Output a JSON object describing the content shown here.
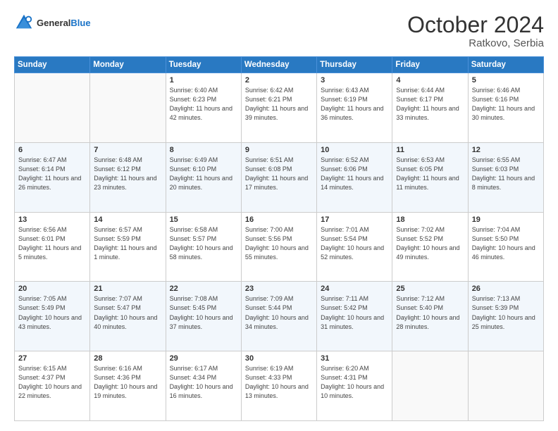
{
  "header": {
    "logo_line1": "General",
    "logo_line2": "Blue",
    "month": "October 2024",
    "location": "Ratkovo, Serbia"
  },
  "weekdays": [
    "Sunday",
    "Monday",
    "Tuesday",
    "Wednesday",
    "Thursday",
    "Friday",
    "Saturday"
  ],
  "weeks": [
    [
      {
        "day": "",
        "sunrise": "",
        "sunset": "",
        "daylight": ""
      },
      {
        "day": "",
        "sunrise": "",
        "sunset": "",
        "daylight": ""
      },
      {
        "day": "1",
        "sunrise": "Sunrise: 6:40 AM",
        "sunset": "Sunset: 6:23 PM",
        "daylight": "Daylight: 11 hours and 42 minutes."
      },
      {
        "day": "2",
        "sunrise": "Sunrise: 6:42 AM",
        "sunset": "Sunset: 6:21 PM",
        "daylight": "Daylight: 11 hours and 39 minutes."
      },
      {
        "day": "3",
        "sunrise": "Sunrise: 6:43 AM",
        "sunset": "Sunset: 6:19 PM",
        "daylight": "Daylight: 11 hours and 36 minutes."
      },
      {
        "day": "4",
        "sunrise": "Sunrise: 6:44 AM",
        "sunset": "Sunset: 6:17 PM",
        "daylight": "Daylight: 11 hours and 33 minutes."
      },
      {
        "day": "5",
        "sunrise": "Sunrise: 6:46 AM",
        "sunset": "Sunset: 6:16 PM",
        "daylight": "Daylight: 11 hours and 30 minutes."
      }
    ],
    [
      {
        "day": "6",
        "sunrise": "Sunrise: 6:47 AM",
        "sunset": "Sunset: 6:14 PM",
        "daylight": "Daylight: 11 hours and 26 minutes."
      },
      {
        "day": "7",
        "sunrise": "Sunrise: 6:48 AM",
        "sunset": "Sunset: 6:12 PM",
        "daylight": "Daylight: 11 hours and 23 minutes."
      },
      {
        "day": "8",
        "sunrise": "Sunrise: 6:49 AM",
        "sunset": "Sunset: 6:10 PM",
        "daylight": "Daylight: 11 hours and 20 minutes."
      },
      {
        "day": "9",
        "sunrise": "Sunrise: 6:51 AM",
        "sunset": "Sunset: 6:08 PM",
        "daylight": "Daylight: 11 hours and 17 minutes."
      },
      {
        "day": "10",
        "sunrise": "Sunrise: 6:52 AM",
        "sunset": "Sunset: 6:06 PM",
        "daylight": "Daylight: 11 hours and 14 minutes."
      },
      {
        "day": "11",
        "sunrise": "Sunrise: 6:53 AM",
        "sunset": "Sunset: 6:05 PM",
        "daylight": "Daylight: 11 hours and 11 minutes."
      },
      {
        "day": "12",
        "sunrise": "Sunrise: 6:55 AM",
        "sunset": "Sunset: 6:03 PM",
        "daylight": "Daylight: 11 hours and 8 minutes."
      }
    ],
    [
      {
        "day": "13",
        "sunrise": "Sunrise: 6:56 AM",
        "sunset": "Sunset: 6:01 PM",
        "daylight": "Daylight: 11 hours and 5 minutes."
      },
      {
        "day": "14",
        "sunrise": "Sunrise: 6:57 AM",
        "sunset": "Sunset: 5:59 PM",
        "daylight": "Daylight: 11 hours and 1 minute."
      },
      {
        "day": "15",
        "sunrise": "Sunrise: 6:58 AM",
        "sunset": "Sunset: 5:57 PM",
        "daylight": "Daylight: 10 hours and 58 minutes."
      },
      {
        "day": "16",
        "sunrise": "Sunrise: 7:00 AM",
        "sunset": "Sunset: 5:56 PM",
        "daylight": "Daylight: 10 hours and 55 minutes."
      },
      {
        "day": "17",
        "sunrise": "Sunrise: 7:01 AM",
        "sunset": "Sunset: 5:54 PM",
        "daylight": "Daylight: 10 hours and 52 minutes."
      },
      {
        "day": "18",
        "sunrise": "Sunrise: 7:02 AM",
        "sunset": "Sunset: 5:52 PM",
        "daylight": "Daylight: 10 hours and 49 minutes."
      },
      {
        "day": "19",
        "sunrise": "Sunrise: 7:04 AM",
        "sunset": "Sunset: 5:50 PM",
        "daylight": "Daylight: 10 hours and 46 minutes."
      }
    ],
    [
      {
        "day": "20",
        "sunrise": "Sunrise: 7:05 AM",
        "sunset": "Sunset: 5:49 PM",
        "daylight": "Daylight: 10 hours and 43 minutes."
      },
      {
        "day": "21",
        "sunrise": "Sunrise: 7:07 AM",
        "sunset": "Sunset: 5:47 PM",
        "daylight": "Daylight: 10 hours and 40 minutes."
      },
      {
        "day": "22",
        "sunrise": "Sunrise: 7:08 AM",
        "sunset": "Sunset: 5:45 PM",
        "daylight": "Daylight: 10 hours and 37 minutes."
      },
      {
        "day": "23",
        "sunrise": "Sunrise: 7:09 AM",
        "sunset": "Sunset: 5:44 PM",
        "daylight": "Daylight: 10 hours and 34 minutes."
      },
      {
        "day": "24",
        "sunrise": "Sunrise: 7:11 AM",
        "sunset": "Sunset: 5:42 PM",
        "daylight": "Daylight: 10 hours and 31 minutes."
      },
      {
        "day": "25",
        "sunrise": "Sunrise: 7:12 AM",
        "sunset": "Sunset: 5:40 PM",
        "daylight": "Daylight: 10 hours and 28 minutes."
      },
      {
        "day": "26",
        "sunrise": "Sunrise: 7:13 AM",
        "sunset": "Sunset: 5:39 PM",
        "daylight": "Daylight: 10 hours and 25 minutes."
      }
    ],
    [
      {
        "day": "27",
        "sunrise": "Sunrise: 6:15 AM",
        "sunset": "Sunset: 4:37 PM",
        "daylight": "Daylight: 10 hours and 22 minutes."
      },
      {
        "day": "28",
        "sunrise": "Sunrise: 6:16 AM",
        "sunset": "Sunset: 4:36 PM",
        "daylight": "Daylight: 10 hours and 19 minutes."
      },
      {
        "day": "29",
        "sunrise": "Sunrise: 6:17 AM",
        "sunset": "Sunset: 4:34 PM",
        "daylight": "Daylight: 10 hours and 16 minutes."
      },
      {
        "day": "30",
        "sunrise": "Sunrise: 6:19 AM",
        "sunset": "Sunset: 4:33 PM",
        "daylight": "Daylight: 10 hours and 13 minutes."
      },
      {
        "day": "31",
        "sunrise": "Sunrise: 6:20 AM",
        "sunset": "Sunset: 4:31 PM",
        "daylight": "Daylight: 10 hours and 10 minutes."
      },
      {
        "day": "",
        "sunrise": "",
        "sunset": "",
        "daylight": ""
      },
      {
        "day": "",
        "sunrise": "",
        "sunset": "",
        "daylight": ""
      }
    ]
  ]
}
